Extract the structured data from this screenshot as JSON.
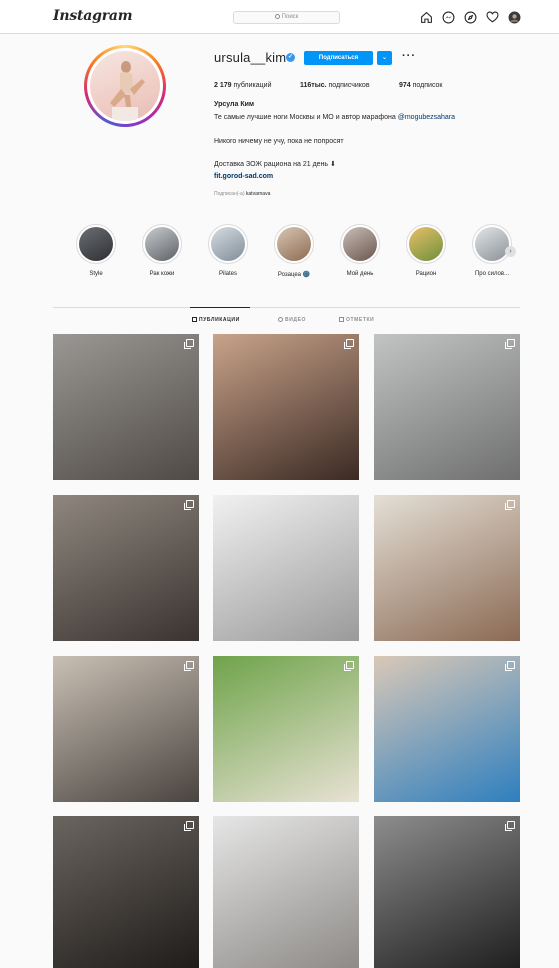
{
  "nav": {
    "logo": "Instagram",
    "search_placeholder": "Поиск",
    "icons": [
      "home-icon",
      "messenger-icon",
      "explore-icon",
      "heart-icon",
      "profile-avatar"
    ]
  },
  "profile": {
    "username": "ursula__kim",
    "verified": true,
    "follow_label": "Подписаться",
    "dropdown_label": "⌄",
    "more_label": "···",
    "stats": {
      "posts_value": "2 179",
      "posts_label": "публикаций",
      "followers_value": "116тыс.",
      "followers_label": "подписчиков",
      "following_value": "974",
      "following_label": "подписок"
    },
    "full_name": "Урсула Ким",
    "bio_line1": "Те самые лучшие ноги Москвы и МО и автор марафона",
    "bio_mention": "@mogubezsahara",
    "bio_line2": "Никого ничему не учу, пока не попросят",
    "bio_line3": "Доставка ЗОЖ рациона на 21 день ⬇",
    "bio_link": "fit.gorod-sad.com",
    "followed_by_prefix": "Подписан(-а)",
    "followed_by_user": "katvarnava"
  },
  "highlights": [
    {
      "label": "Style",
      "color_a": "#6b6f74",
      "color_b": "#2e2f33"
    },
    {
      "label": "Рак кожи",
      "color_a": "#c9cccf",
      "color_b": "#5d6166"
    },
    {
      "label": "Pilates",
      "color_a": "#d7dde2",
      "color_b": "#7f8d99"
    },
    {
      "label": "Розацеа 🌚",
      "color_a": "#d9c6b4",
      "color_b": "#8c6b51"
    },
    {
      "label": "Мой день",
      "color_a": "#c9bfb8",
      "color_b": "#6a564d"
    },
    {
      "label": "Рацион",
      "color_a": "#e8c068",
      "color_b": "#6f8f3c"
    },
    {
      "label": "Про силов...",
      "color_a": "#e3e6e8",
      "color_b": "#8a9197"
    }
  ],
  "highlights_next": "›",
  "tabs": [
    {
      "label": "ПУБЛИКАЦИИ",
      "active": true
    },
    {
      "label": "ВИДЕО",
      "active": false
    },
    {
      "label": "ОТМЕТКИ",
      "active": false
    }
  ],
  "posts": [
    {
      "bg_a": "#9a9794",
      "bg_b": "#4f4a46",
      "multi": true
    },
    {
      "bg_a": "#c9a38a",
      "bg_b": "#3b2a24",
      "multi": true
    },
    {
      "bg_a": "#c2c4c4",
      "bg_b": "#6e6f6e",
      "multi": true
    },
    {
      "bg_a": "#8f877e",
      "bg_b": "#3a3330",
      "multi": true
    },
    {
      "bg_a": "#f1f1f1",
      "bg_b": "#9a9a9a",
      "multi": false
    },
    {
      "bg_a": "#e4dfd6",
      "bg_b": "#8b6a54",
      "multi": true
    },
    {
      "bg_a": "#c9c0b4",
      "bg_b": "#4a4440",
      "multi": true
    },
    {
      "bg_a": "#6fa34a",
      "bg_b": "#e8e2d4",
      "multi": true
    },
    {
      "bg_a": "#d9c8b7",
      "bg_b": "#2e7fbf",
      "multi": true
    },
    {
      "bg_a": "#6b6560",
      "bg_b": "#1f1c1a",
      "multi": true
    },
    {
      "bg_a": "#e6e6e6",
      "bg_b": "#8d8a87",
      "multi": false
    },
    {
      "bg_a": "#8d8d8d",
      "bg_b": "#1f1f1f",
      "multi": true
    }
  ]
}
